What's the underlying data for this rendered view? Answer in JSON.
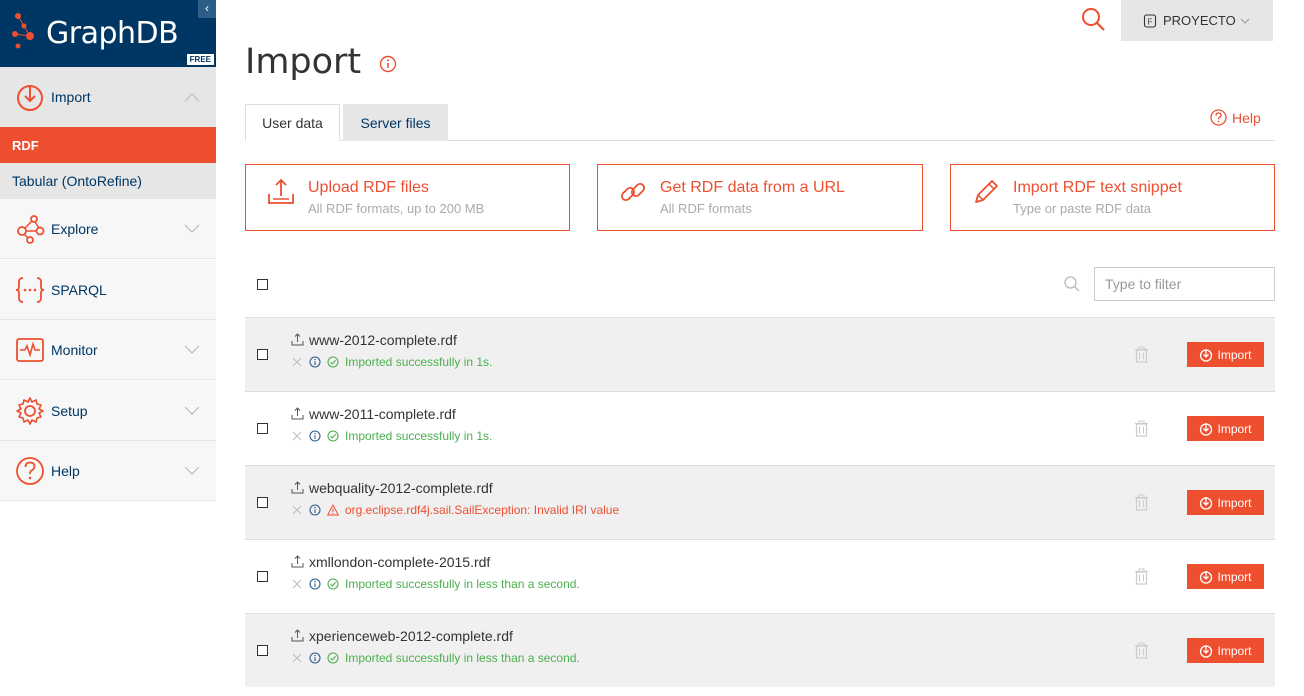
{
  "logo": {
    "text": "GraphDB",
    "badge": "FREE"
  },
  "sidebar": {
    "items": [
      {
        "label": "Import",
        "icon": "import-icon"
      },
      {
        "label": "Explore",
        "icon": "explore-icon"
      },
      {
        "label": "SPARQL",
        "icon": "sparql-icon"
      },
      {
        "label": "Monitor",
        "icon": "monitor-icon"
      },
      {
        "label": "Setup",
        "icon": "setup-icon"
      },
      {
        "label": "Help",
        "icon": "help-icon"
      }
    ],
    "sub": {
      "rdf": "RDF",
      "tabular": "Tabular (OntoRefine)"
    }
  },
  "header": {
    "repo": "PROYECTO"
  },
  "page": {
    "title": "Import"
  },
  "tabs": {
    "user": "User data",
    "server": "Server files",
    "help": "Help"
  },
  "cards": [
    {
      "title": "Upload RDF files",
      "sub": "All RDF formats, up to 200 MB"
    },
    {
      "title": "Get RDF data from a URL",
      "sub": "All RDF formats"
    },
    {
      "title": "Import RDF text snippet",
      "sub": "Type or paste RDF data"
    }
  ],
  "filter": {
    "placeholder": "Type to filter"
  },
  "files": [
    {
      "name": "www-2012-complete.rdf",
      "status": "Imported successfully in 1s.",
      "ok": true,
      "button": "Import"
    },
    {
      "name": "www-2011-complete.rdf",
      "status": "Imported successfully in 1s.",
      "ok": true,
      "button": "Import"
    },
    {
      "name": "webquality-2012-complete.rdf",
      "status": "org.eclipse.rdf4j.sail.SailException: Invalid IRI value",
      "ok": false,
      "button": "Import"
    },
    {
      "name": "xmllondon-complete-2015.rdf",
      "status": "Imported successfully in less than a second.",
      "ok": true,
      "button": "Import"
    },
    {
      "name": "xperienceweb-2012-complete.rdf",
      "status": "Imported successfully in less than a second.",
      "ok": true,
      "button": "Import"
    }
  ],
  "colors": {
    "accent": "#ed4f2f",
    "navy": "#003663",
    "success": "#4caf50"
  }
}
